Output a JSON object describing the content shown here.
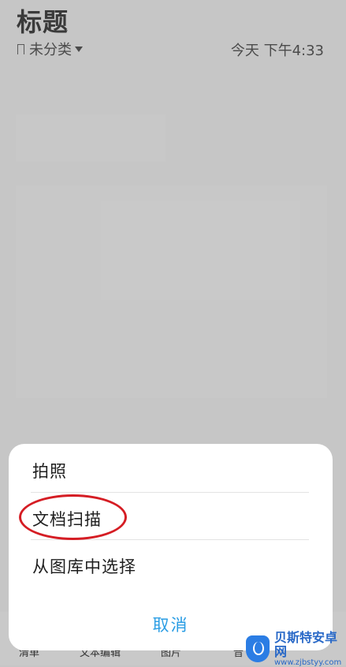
{
  "header": {
    "title": "标题",
    "category": "未分类",
    "timestamp": "今天 下午4:33"
  },
  "toolbar": {
    "items": [
      "清单",
      "文本编辑",
      "图片",
      "音"
    ]
  },
  "sheet": {
    "options": [
      "拍照",
      "文档扫描",
      "从图库中选择"
    ],
    "cancel": "取消",
    "accent_color": "#2A9DE4"
  },
  "annotation": {
    "highlight_color": "#D51D24"
  },
  "watermark": {
    "name": "贝斯特安卓网",
    "url": "www.zjbstyy.com"
  }
}
